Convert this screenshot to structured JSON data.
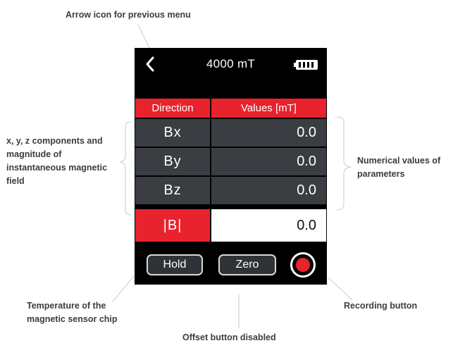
{
  "annotations": {
    "arrow_icon": "Arrow icon for previous menu",
    "components": "x, y, z components and magnitude of instantaneous magnetic field",
    "numerical_values": "Numerical values of parameters",
    "temperature": "Temperature of the magnetic sensor chip",
    "recording": "Recording button",
    "offset": "Offset button disabled"
  },
  "device": {
    "range_label": "4000 mT",
    "battery_icon": "battery-full-icon",
    "back_icon": "chevron-left-icon",
    "table": {
      "headers": [
        "Direction",
        "Values [mT]"
      ],
      "rows": [
        {
          "direction": "Bx",
          "value": "0.0"
        },
        {
          "direction": "By",
          "value": "0.0"
        },
        {
          "direction": "Bz",
          "value": "0.0"
        },
        {
          "direction": "|B|",
          "value": "0.0"
        }
      ]
    },
    "buttons": {
      "hold": "Hold",
      "zero": "Zero"
    },
    "record_icon": "record-icon",
    "colors": {
      "accent": "#e8232d",
      "row_bg": "#3a3d41",
      "screen_bg": "#000000"
    }
  }
}
